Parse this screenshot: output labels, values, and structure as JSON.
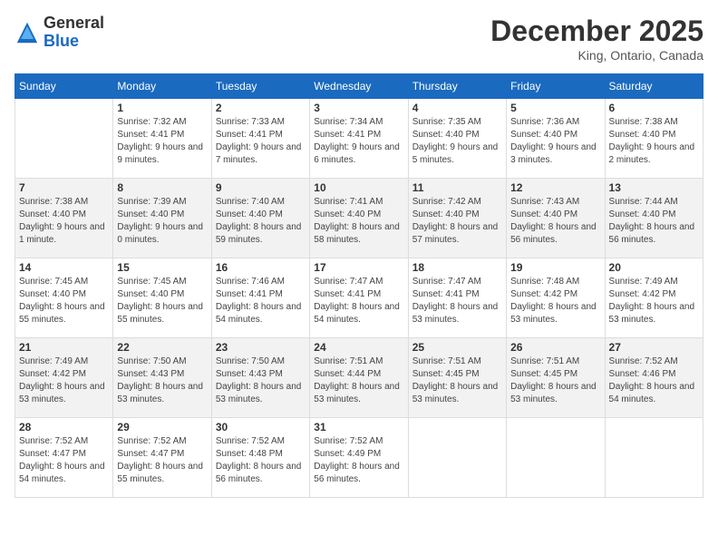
{
  "logo": {
    "general": "General",
    "blue": "Blue"
  },
  "title": "December 2025",
  "location": "King, Ontario, Canada",
  "days_of_week": [
    "Sunday",
    "Monday",
    "Tuesday",
    "Wednesday",
    "Thursday",
    "Friday",
    "Saturday"
  ],
  "weeks": [
    [
      {
        "day": "",
        "sunrise": "",
        "sunset": "",
        "daylight": ""
      },
      {
        "day": "1",
        "sunrise": "Sunrise: 7:32 AM",
        "sunset": "Sunset: 4:41 PM",
        "daylight": "Daylight: 9 hours and 9 minutes."
      },
      {
        "day": "2",
        "sunrise": "Sunrise: 7:33 AM",
        "sunset": "Sunset: 4:41 PM",
        "daylight": "Daylight: 9 hours and 7 minutes."
      },
      {
        "day": "3",
        "sunrise": "Sunrise: 7:34 AM",
        "sunset": "Sunset: 4:41 PM",
        "daylight": "Daylight: 9 hours and 6 minutes."
      },
      {
        "day": "4",
        "sunrise": "Sunrise: 7:35 AM",
        "sunset": "Sunset: 4:40 PM",
        "daylight": "Daylight: 9 hours and 5 minutes."
      },
      {
        "day": "5",
        "sunrise": "Sunrise: 7:36 AM",
        "sunset": "Sunset: 4:40 PM",
        "daylight": "Daylight: 9 hours and 3 minutes."
      },
      {
        "day": "6",
        "sunrise": "Sunrise: 7:38 AM",
        "sunset": "Sunset: 4:40 PM",
        "daylight": "Daylight: 9 hours and 2 minutes."
      }
    ],
    [
      {
        "day": "7",
        "sunrise": "Sunrise: 7:38 AM",
        "sunset": "Sunset: 4:40 PM",
        "daylight": "Daylight: 9 hours and 1 minute."
      },
      {
        "day": "8",
        "sunrise": "Sunrise: 7:39 AM",
        "sunset": "Sunset: 4:40 PM",
        "daylight": "Daylight: 9 hours and 0 minutes."
      },
      {
        "day": "9",
        "sunrise": "Sunrise: 7:40 AM",
        "sunset": "Sunset: 4:40 PM",
        "daylight": "Daylight: 8 hours and 59 minutes."
      },
      {
        "day": "10",
        "sunrise": "Sunrise: 7:41 AM",
        "sunset": "Sunset: 4:40 PM",
        "daylight": "Daylight: 8 hours and 58 minutes."
      },
      {
        "day": "11",
        "sunrise": "Sunrise: 7:42 AM",
        "sunset": "Sunset: 4:40 PM",
        "daylight": "Daylight: 8 hours and 57 minutes."
      },
      {
        "day": "12",
        "sunrise": "Sunrise: 7:43 AM",
        "sunset": "Sunset: 4:40 PM",
        "daylight": "Daylight: 8 hours and 56 minutes."
      },
      {
        "day": "13",
        "sunrise": "Sunrise: 7:44 AM",
        "sunset": "Sunset: 4:40 PM",
        "daylight": "Daylight: 8 hours and 56 minutes."
      }
    ],
    [
      {
        "day": "14",
        "sunrise": "Sunrise: 7:45 AM",
        "sunset": "Sunset: 4:40 PM",
        "daylight": "Daylight: 8 hours and 55 minutes."
      },
      {
        "day": "15",
        "sunrise": "Sunrise: 7:45 AM",
        "sunset": "Sunset: 4:40 PM",
        "daylight": "Daylight: 8 hours and 55 minutes."
      },
      {
        "day": "16",
        "sunrise": "Sunrise: 7:46 AM",
        "sunset": "Sunset: 4:41 PM",
        "daylight": "Daylight: 8 hours and 54 minutes."
      },
      {
        "day": "17",
        "sunrise": "Sunrise: 7:47 AM",
        "sunset": "Sunset: 4:41 PM",
        "daylight": "Daylight: 8 hours and 54 minutes."
      },
      {
        "day": "18",
        "sunrise": "Sunrise: 7:47 AM",
        "sunset": "Sunset: 4:41 PM",
        "daylight": "Daylight: 8 hours and 53 minutes."
      },
      {
        "day": "19",
        "sunrise": "Sunrise: 7:48 AM",
        "sunset": "Sunset: 4:42 PM",
        "daylight": "Daylight: 8 hours and 53 minutes."
      },
      {
        "day": "20",
        "sunrise": "Sunrise: 7:49 AM",
        "sunset": "Sunset: 4:42 PM",
        "daylight": "Daylight: 8 hours and 53 minutes."
      }
    ],
    [
      {
        "day": "21",
        "sunrise": "Sunrise: 7:49 AM",
        "sunset": "Sunset: 4:42 PM",
        "daylight": "Daylight: 8 hours and 53 minutes."
      },
      {
        "day": "22",
        "sunrise": "Sunrise: 7:50 AM",
        "sunset": "Sunset: 4:43 PM",
        "daylight": "Daylight: 8 hours and 53 minutes."
      },
      {
        "day": "23",
        "sunrise": "Sunrise: 7:50 AM",
        "sunset": "Sunset: 4:43 PM",
        "daylight": "Daylight: 8 hours and 53 minutes."
      },
      {
        "day": "24",
        "sunrise": "Sunrise: 7:51 AM",
        "sunset": "Sunset: 4:44 PM",
        "daylight": "Daylight: 8 hours and 53 minutes."
      },
      {
        "day": "25",
        "sunrise": "Sunrise: 7:51 AM",
        "sunset": "Sunset: 4:45 PM",
        "daylight": "Daylight: 8 hours and 53 minutes."
      },
      {
        "day": "26",
        "sunrise": "Sunrise: 7:51 AM",
        "sunset": "Sunset: 4:45 PM",
        "daylight": "Daylight: 8 hours and 53 minutes."
      },
      {
        "day": "27",
        "sunrise": "Sunrise: 7:52 AM",
        "sunset": "Sunset: 4:46 PM",
        "daylight": "Daylight: 8 hours and 54 minutes."
      }
    ],
    [
      {
        "day": "28",
        "sunrise": "Sunrise: 7:52 AM",
        "sunset": "Sunset: 4:47 PM",
        "daylight": "Daylight: 8 hours and 54 minutes."
      },
      {
        "day": "29",
        "sunrise": "Sunrise: 7:52 AM",
        "sunset": "Sunset: 4:47 PM",
        "daylight": "Daylight: 8 hours and 55 minutes."
      },
      {
        "day": "30",
        "sunrise": "Sunrise: 7:52 AM",
        "sunset": "Sunset: 4:48 PM",
        "daylight": "Daylight: 8 hours and 56 minutes."
      },
      {
        "day": "31",
        "sunrise": "Sunrise: 7:52 AM",
        "sunset": "Sunset: 4:49 PM",
        "daylight": "Daylight: 8 hours and 56 minutes."
      },
      {
        "day": "",
        "sunrise": "",
        "sunset": "",
        "daylight": ""
      },
      {
        "day": "",
        "sunrise": "",
        "sunset": "",
        "daylight": ""
      },
      {
        "day": "",
        "sunrise": "",
        "sunset": "",
        "daylight": ""
      }
    ]
  ]
}
